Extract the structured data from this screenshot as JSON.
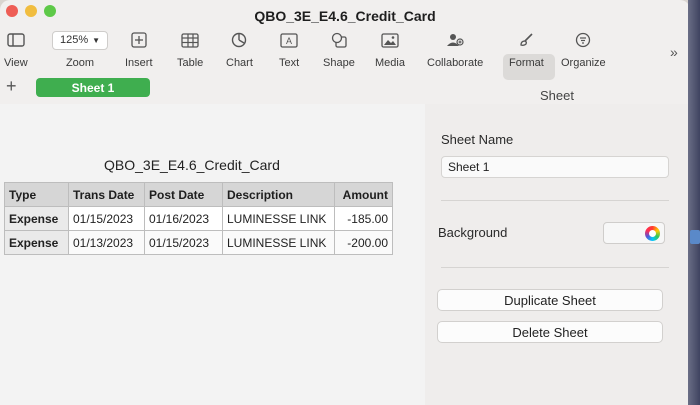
{
  "window": {
    "title": "QBO_3E_E4.6_Credit_Card"
  },
  "toolbar": {
    "view": "View",
    "zoom_value": "125%",
    "zoom": "Zoom",
    "insert": "Insert",
    "table": "Table",
    "chart": "Chart",
    "text": "Text",
    "shape": "Shape",
    "media": "Media",
    "collaborate": "Collaborate",
    "format": "Format",
    "organize": "Organize",
    "more": "»"
  },
  "tabs": {
    "add": "+",
    "sheet": "Sheet 1"
  },
  "sidebar": {
    "header": "Sheet",
    "sheet_name_label": "Sheet Name",
    "sheet_name_value": "Sheet 1",
    "background_label": "Background",
    "duplicate_button": "Duplicate Sheet",
    "delete_button": "Delete Sheet"
  },
  "table": {
    "title": "QBO_3E_E4.6_Credit_Card",
    "headers": [
      "Type",
      "Trans Date",
      "Post Date",
      "Description",
      "Amount"
    ],
    "rows": [
      [
        "Expense",
        "01/15/2023",
        "01/16/2023",
        "LUMINESSE LINK",
        "-185.00"
      ],
      [
        "Expense",
        "01/13/2023",
        "01/15/2023",
        "LUMINESSE LINK",
        "-200.00"
      ]
    ]
  },
  "colors": {
    "sheet_tab": "#3fae4f",
    "accent": "#3fae4f"
  }
}
